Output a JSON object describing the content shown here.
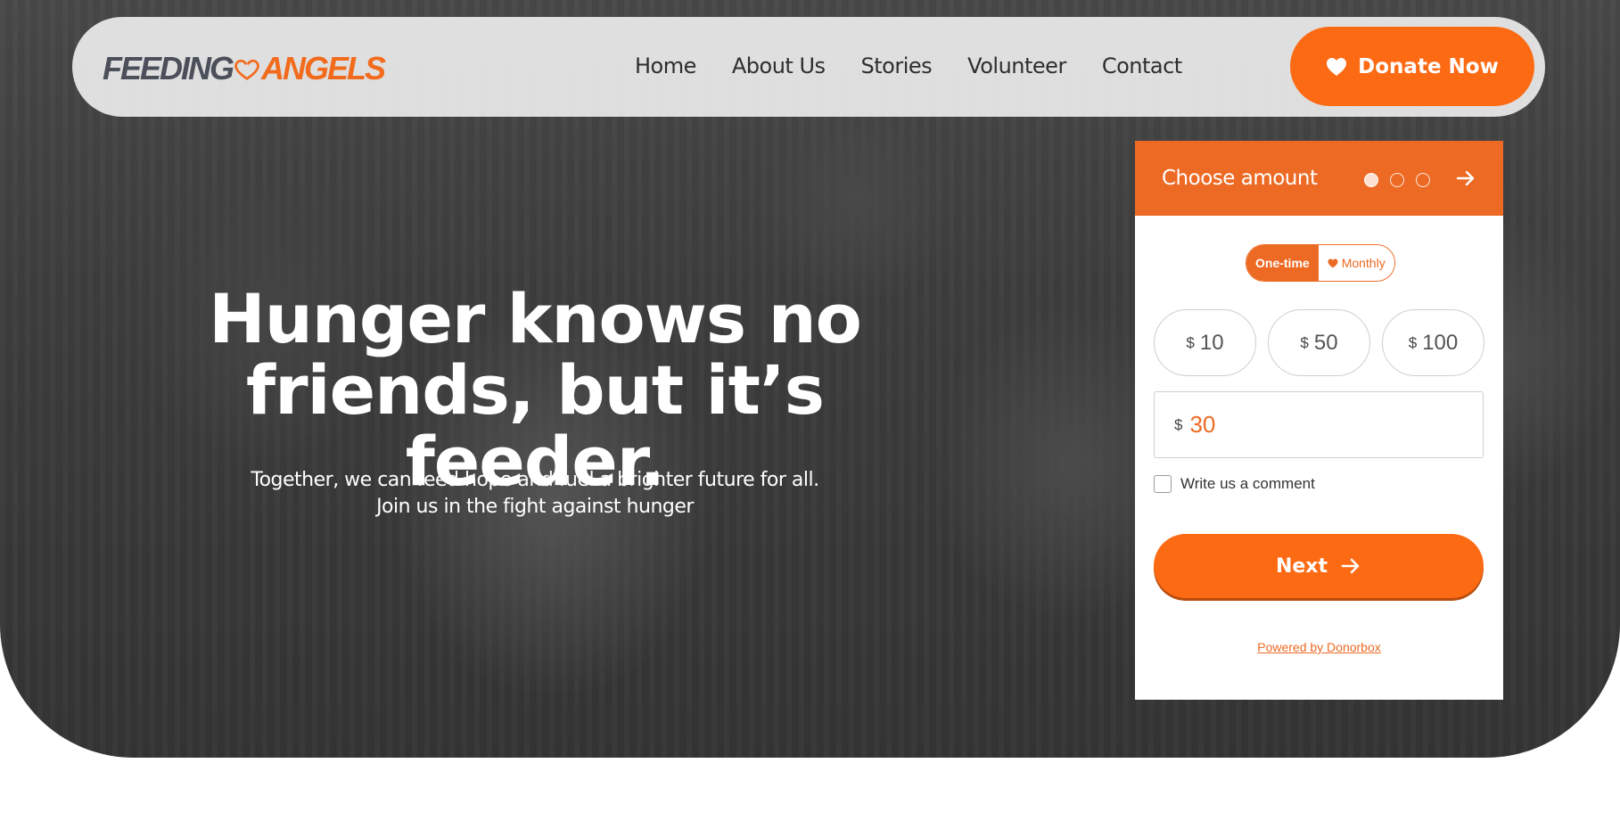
{
  "brand": {
    "logo_part1": "FEEDING",
    "logo_part2": "ANGELS",
    "accent_color": "#fc6a14",
    "logo_icon": "heart-icon"
  },
  "nav": {
    "items": [
      {
        "label": "Home"
      },
      {
        "label": "About Us"
      },
      {
        "label": "Stories"
      },
      {
        "label": "Volunteer"
      },
      {
        "label": "Contact"
      }
    ],
    "donate_label": "Donate Now",
    "donate_icon": "heart-icon"
  },
  "hero": {
    "headline_line1": "Hunger knows no",
    "headline_line2": "friends, but it’s feeder.",
    "sub_line1": "Together, we can feed hope and fuel a brighter future for all.",
    "sub_line2": "Join us in the fight against hunger"
  },
  "widget": {
    "title": "Choose amount",
    "steps_total": 3,
    "step_current": 1,
    "frequency": {
      "one_time": "One-time",
      "monthly": "Monthly",
      "selected": "One-time"
    },
    "currency": "$",
    "amounts": [
      "10",
      "50",
      "100"
    ],
    "custom_amount": "30",
    "comment_label": "Write us a comment",
    "next_label": "Next",
    "powered_by": "Powered by Donorbox"
  }
}
